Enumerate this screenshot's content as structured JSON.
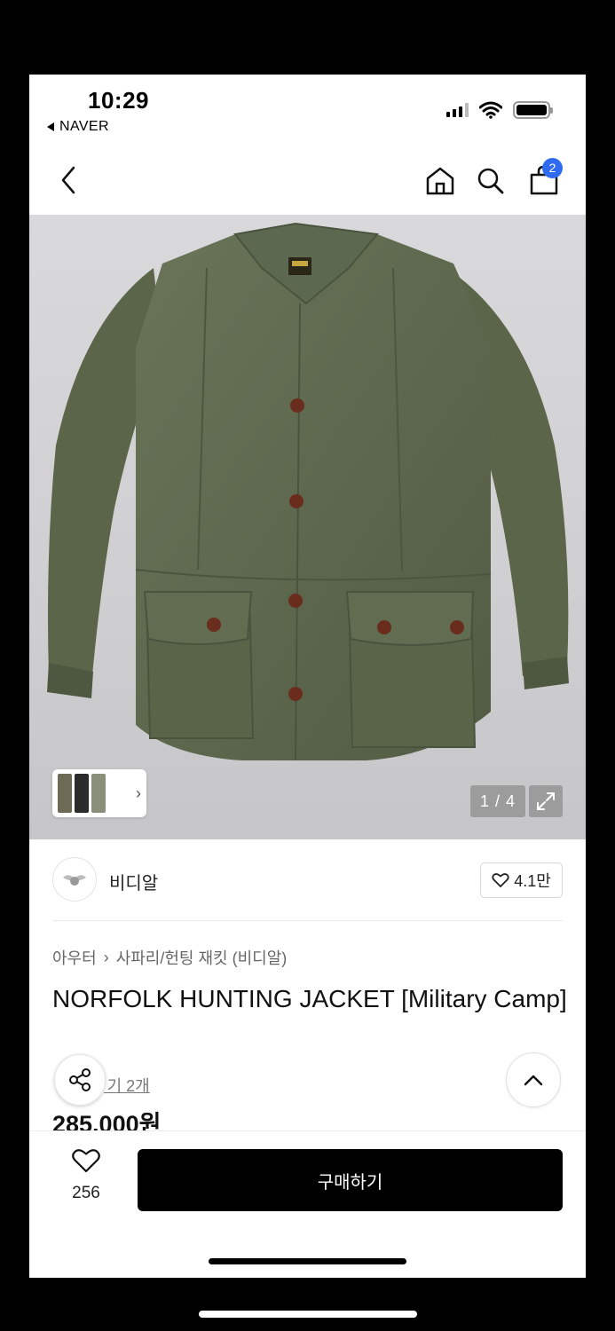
{
  "status_bar": {
    "time": "10:29",
    "back_app": "NAVER"
  },
  "nav": {
    "cart_count": "2"
  },
  "gallery": {
    "counter": "1 / 4"
  },
  "brand": {
    "name": "비디알",
    "likes": "4.1만"
  },
  "breadcrumb": {
    "category": "아우터",
    "separator": "›",
    "subcategory": "사파리/헌팅 재킷 (비디알)"
  },
  "product": {
    "title": "NORFOLK HUNTING JACKET [Military Camp]",
    "review_link": " 기 2개",
    "price": "285,000원"
  },
  "bottom_bar": {
    "wishlist_count": "256",
    "buy_label": "구매하기"
  },
  "colors": {
    "accent_badge": "#2f6bf0",
    "buy_button": "#000000",
    "jacket": "#5f6a4f"
  },
  "icons": [
    "back-chevron-icon",
    "home-icon",
    "search-icon",
    "shopping-bag-icon",
    "expand-icon",
    "heart-icon",
    "share-icon",
    "chevron-up-icon"
  ]
}
